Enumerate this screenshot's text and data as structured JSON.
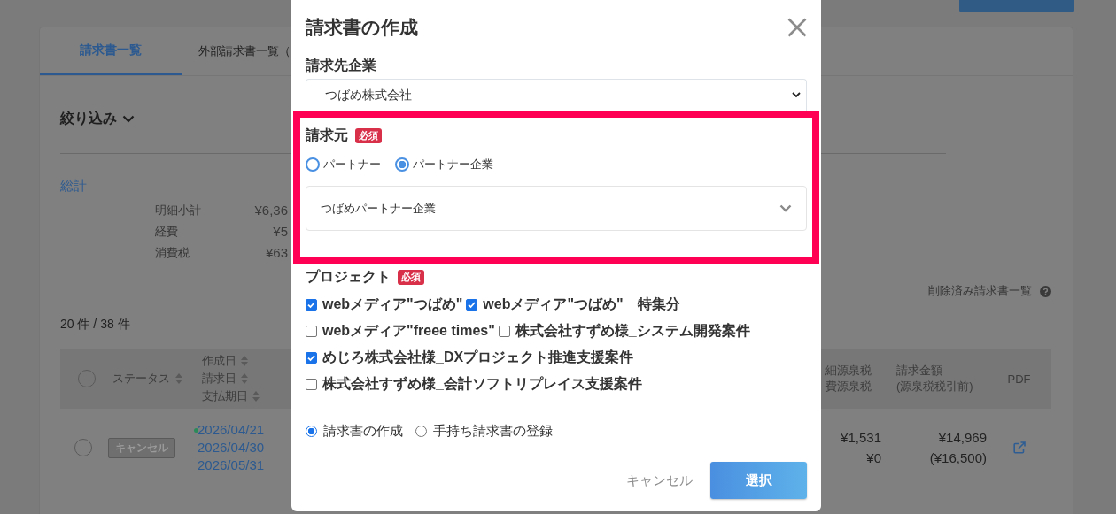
{
  "background_page": {
    "tabs": [
      {
        "label": "請求書一覧",
        "selected": true
      },
      {
        "label": "外部請求書一覧（",
        "selected": false
      }
    ],
    "filter_toggle": "絞り込み",
    "summary": {
      "title": "総計",
      "rows": [
        {
          "label": "明細小計",
          "value": "¥6,36"
        },
        {
          "label": "経費",
          "value": "¥5"
        },
        {
          "label": "消費税",
          "value": "¥63"
        }
      ]
    },
    "deleted_link": "削除済み請求書一覧",
    "count": "20 件 / 38 件",
    "table": {
      "header": {
        "selected": false,
        "status": "ステータス",
        "dates": [
          "作成日",
          "請求日",
          "支払期日"
        ],
        "withholding": [
          "細源泉税",
          "費源泉税"
        ],
        "amount": [
          "請求金額",
          "(源泉税税引前)"
        ],
        "pdf": "PDF"
      },
      "rows": [
        {
          "selected": false,
          "status": "キャンセル",
          "dates": [
            "2026/04/21",
            "2026/04/30",
            "2026/05/31"
          ],
          "withholding": [
            "¥1,531",
            "¥0"
          ],
          "amount": [
            "¥14,969",
            "(¥16,500)"
          ]
        }
      ]
    }
  },
  "dialog": {
    "title": "請求書の作成",
    "billing_to": {
      "label": "請求先企業",
      "value": "つばめ株式会社"
    },
    "issuer": {
      "label": "請求元",
      "required": "必須",
      "highlighted": true,
      "options": [
        {
          "label": "パートナー",
          "selected": false
        },
        {
          "label": "パートナー企業",
          "selected": true
        }
      ],
      "value": "つばめパートナー企業"
    },
    "project": {
      "label": "プロジェクト",
      "required": "必須",
      "items": [
        {
          "label": "webメディア\"つばめ\"",
          "checked": true
        },
        {
          "label": "webメディア\"つばめ\"　特集分",
          "checked": true
        },
        {
          "label": "webメディア\"freee times\"",
          "checked": false
        },
        {
          "label": "株式会社すずめ様_システム開発案件",
          "checked": false
        },
        {
          "label": "めじろ株式会社様_DXプロジェクト推進支援案件",
          "checked": true
        },
        {
          "label": "株式会社すずめ様_会計ソフトリプレイス支援案件",
          "checked": false
        }
      ]
    },
    "mode_options": [
      {
        "label": "請求書の作成",
        "selected": true
      },
      {
        "label": "手持ち請求書の登録",
        "selected": false
      }
    ],
    "buttons": [
      {
        "label": "キャンセル",
        "kind": "text"
      },
      {
        "label": "選択",
        "kind": "primary"
      }
    ]
  }
}
